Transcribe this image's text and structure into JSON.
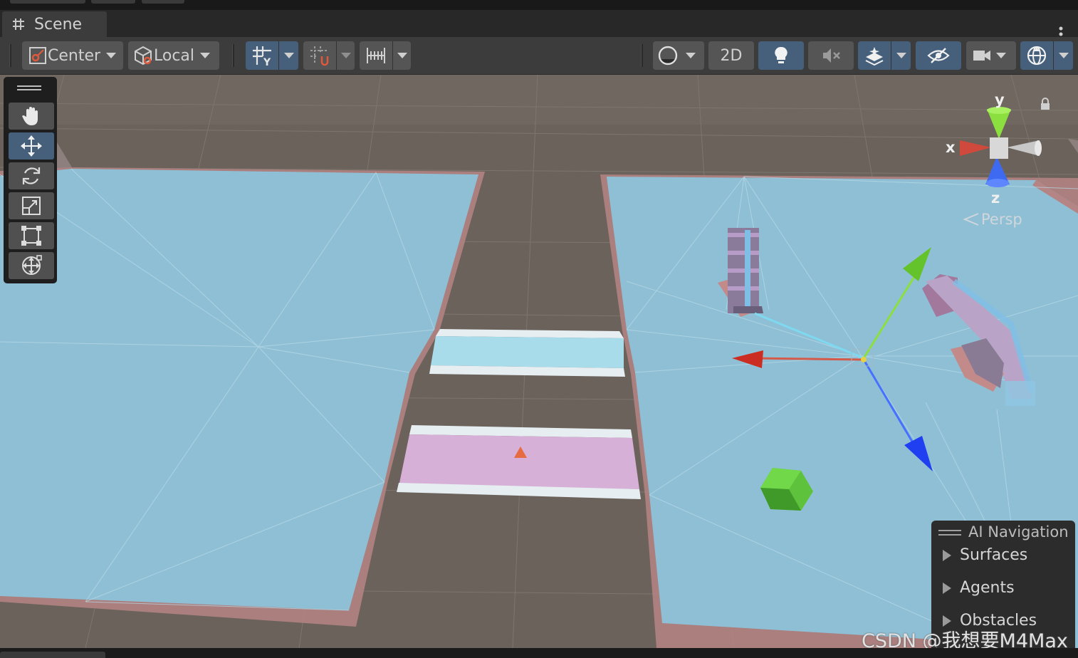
{
  "window": {
    "tab_label": "Scene"
  },
  "toolbar": {
    "pivot_mode": "Center",
    "pivot_space": "Local",
    "view_2d": "2D"
  },
  "tools": [
    "hand-tool",
    "move-tool",
    "rotate-tool",
    "scale-tool",
    "rect-tool",
    "transform-tool"
  ],
  "active_tool": "move-tool",
  "scene_gizmo": {
    "axis_x": "x",
    "axis_y": "y",
    "axis_z": "z",
    "projection": "Persp"
  },
  "ai_navigation": {
    "title": "AI Navigation",
    "items": [
      "Surfaces",
      "Agents",
      "Obstacles"
    ]
  },
  "watermark": "CSDN @我想要M4Max",
  "colors": {
    "navmesh": "#8fbfd4",
    "ground": "#6a615a",
    "accent_active": "#46607c",
    "axis_x": "#d0453a",
    "axis_y": "#7fe040",
    "axis_z": "#3a62f0"
  }
}
